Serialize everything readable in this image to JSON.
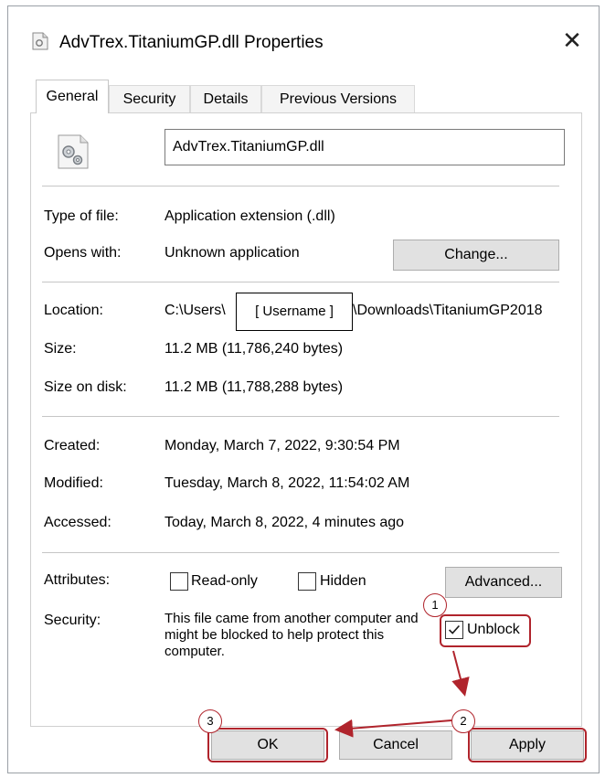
{
  "window": {
    "title": "AdvTrex.TitaniumGP.dll Properties",
    "close_glyph": "✕",
    "title_icon": "dll-file-icon"
  },
  "tabs": [
    {
      "label": "General",
      "active": true
    },
    {
      "label": "Security",
      "active": false
    },
    {
      "label": "Details",
      "active": false
    },
    {
      "label": "Previous Versions",
      "active": false
    }
  ],
  "general": {
    "file_icon": "gear-file-icon",
    "filename": "AdvTrex.TitaniumGP.dll",
    "type_label": "Type of file:",
    "type_value": "Application extension (.dll)",
    "opens_label": "Opens with:",
    "opens_value": "Unknown application",
    "change_button": "Change...",
    "location_label": "Location:",
    "location_value_prefix": "C:\\Users\\",
    "location_value_suffix": "\\Downloads\\TitaniumGP2018",
    "redacted_username": "[ Username ]",
    "size_label": "Size:",
    "size_value": "11.2 MB (11,786,240 bytes)",
    "size_on_disk_label": "Size on disk:",
    "size_on_disk_value": "11.2 MB (11,788,288 bytes)",
    "created_label": "Created:",
    "created_value": "Monday, March 7, 2022, 9:30:54 PM",
    "modified_label": "Modified:",
    "modified_value": "Tuesday, March 8, 2022, 11:54:02 AM",
    "accessed_label": "Accessed:",
    "accessed_value": "Today, March 8, 2022, 4 minutes ago",
    "attributes_label": "Attributes:",
    "readonly_label": "Read-only",
    "readonly_checked": false,
    "hidden_label": "Hidden",
    "hidden_checked": false,
    "advanced_button": "Advanced...",
    "security_label": "Security:",
    "security_text": "This file came from another computer and might be blocked to help protect this computer.",
    "unblock_label": "Unblock",
    "unblock_checked": true
  },
  "footer": {
    "ok_button": "OK",
    "cancel_button": "Cancel",
    "apply_button": "Apply"
  },
  "annotations": {
    "step1": "1",
    "step2": "2",
    "step3": "3",
    "color": "#b0242c"
  }
}
